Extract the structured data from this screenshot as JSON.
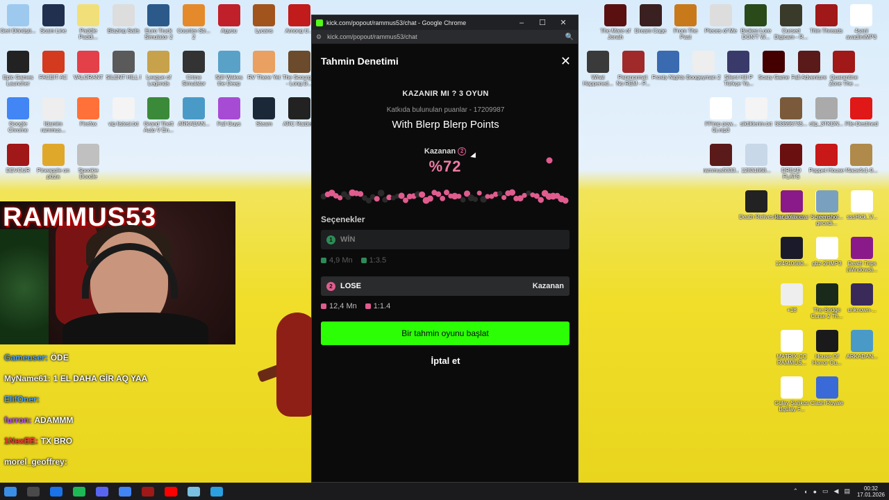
{
  "desktop": {
    "left_icons": [
      {
        "label": "Geri Dönüşü...",
        "color": "#9ec9ef"
      },
      {
        "label": "Scam Line",
        "color": "#22304f"
      },
      {
        "label": "Paddle Paddi...",
        "color": "#f1e07a"
      },
      {
        "label": "Blazing Sails",
        "color": "#ddd"
      },
      {
        "label": "Euro Truck Simulator 2",
        "color": "#2b5a8a"
      },
      {
        "label": "Counter-Str... 2",
        "color": "#e58a2a"
      },
      {
        "label": "Agyou",
        "color": "#c0202a"
      },
      {
        "label": "Lycans",
        "color": "#a2541d"
      },
      {
        "label": "Among U...",
        "color": "#c21b1b"
      },
      {
        "label": "Epic Games Launcher",
        "color": "#222"
      },
      {
        "label": "FACEIT AC",
        "color": "#d43a1d"
      },
      {
        "label": "VALORANT",
        "color": "#e3404a"
      },
      {
        "label": "SILENT HILL f",
        "color": "#5a5a5a"
      },
      {
        "label": "League of Legends",
        "color": "#c7a24a"
      },
      {
        "label": "Crime Simulator",
        "color": "#333"
      },
      {
        "label": "Still Wakes the Deep",
        "color": "#5aa1c7"
      },
      {
        "label": "RV There Yet",
        "color": "#e9a060"
      },
      {
        "label": "The Scourg... - Long D...",
        "color": "#6b4b2b"
      },
      {
        "label": "Google Chrome",
        "color": "#4285f4"
      },
      {
        "label": "İdamim rammus...",
        "color": "#eee"
      },
      {
        "label": "Firefox",
        "color": "#ff7139"
      },
      {
        "label": "vip listesi.txt",
        "color": "#f4f4f4"
      },
      {
        "label": "Grand Theft Auto V En...",
        "color": "#3a8a3a"
      },
      {
        "label": "ARKADAN...",
        "color": "#4a9ac8"
      },
      {
        "label": "Fall Guys",
        "color": "#a74bd5"
      },
      {
        "label": "Steam",
        "color": "#1b2838"
      },
      {
        "label": "ARC Raiders",
        "color": "#222"
      },
      {
        "label": "DEVOUR",
        "color": "#a01818"
      },
      {
        "label": "Pineapple on pizza",
        "color": "#e0a82a"
      },
      {
        "label": "Spookie Doodle",
        "color": "#c0c0c0"
      }
    ],
    "right_icons": [
      {
        "label": "The Mare of Jonah",
        "color": "#5a1010"
      },
      {
        "label": "Dream Cage",
        "color": "#3a2020"
      },
      {
        "label": "From The Past",
        "color": "#c87a1a"
      },
      {
        "label": "Pieces of Me",
        "color": "#ddd"
      },
      {
        "label": "Broken Lore DON'T W...",
        "color": "#2a4a1a"
      },
      {
        "label": "Cursed Digicam - R...",
        "color": "#3a3a2a"
      },
      {
        "label": "Thin Threads",
        "color": "#a01818"
      },
      {
        "label": "4sani avadiiniMP3",
        "color": "#fff"
      },
      {
        "label": "What Happened...",
        "color": "#3a3a3a"
      },
      {
        "label": "Paranormal: No REM - P...",
        "color": "#a02a2a"
      },
      {
        "label": "Frosty Nights",
        "color": "#3a6ab0"
      },
      {
        "label": "Boogeyman 2",
        "color": "#eee"
      },
      {
        "label": "Silent Hill P Türkçe Ya...",
        "color": "#3a3a6a"
      },
      {
        "label": "Scary Game",
        "color": "#400"
      },
      {
        "label": "Fall Adventure",
        "color": "#5a1a1a"
      },
      {
        "label": "Quarantine Zone The ...",
        "color": "#a01818"
      },
      {
        "label": "FFimp pow... 0).mp3",
        "color": "#fff"
      },
      {
        "label": "siktiklerim.txt",
        "color": "#f4f4f4"
      },
      {
        "label": "533595735...",
        "color": "#7a5a3a"
      },
      {
        "label": "clip_3TKDN...",
        "color": "#aaa"
      },
      {
        "label": "File-Destined",
        "color": "#e01818"
      },
      {
        "label": "rammus5333...",
        "color": "#5a1a1a"
      },
      {
        "label": "12831868...",
        "color": "#c8d8e8"
      },
      {
        "label": "DREAD FLATS",
        "color": "#6a1010"
      },
      {
        "label": "Poppet House",
        "color": "#c81818"
      },
      {
        "label": "f4aca4c1-0...",
        "color": "#b08a4a"
      },
      {
        "label": "Death Relives",
        "color": "#222"
      },
      {
        "label": "tarzan53nw...",
        "color": "#2a5a2a"
      },
      {
        "label": "anneme gecedi...",
        "color": "#fff"
      },
      {
        "label": "Rar dolaxicrar",
        "color": "#8a1a8a"
      },
      {
        "label": "Screenshot...",
        "color": "#7aa0c0"
      },
      {
        "label": "sssHktk_V...",
        "color": "#fff"
      },
      {
        "label": "124910680...",
        "color": "#1a1a2a"
      },
      {
        "label": "gbz-2HMP3",
        "color": "#fff"
      },
      {
        "label": "Death Trips (Windows)...",
        "color": "#8a1a8a"
      },
      {
        "label": "+18",
        "color": "#eee"
      },
      {
        "label": "The Bridge Curse 2 Th...",
        "color": "#1a2a1a"
      },
      {
        "label": "unknown-...",
        "color": "#3a2a5a"
      },
      {
        "label": "MATRIX ÇÇ RAMMUS...",
        "color": "#fff"
      },
      {
        "label": "House Of Horror Ou...",
        "color": "#1a1a1a"
      },
      {
        "label": "ARKADAN...",
        "color": "#4a9ac8"
      },
      {
        "label": "Gülay Şahkos Bgülay F...",
        "color": "#fff"
      },
      {
        "label": "Clash Royale",
        "color": "#3a6ad8"
      }
    ]
  },
  "webcam": {
    "overlay_text": "RAMMUS53"
  },
  "chat": {
    "lines": [
      {
        "user": "Gameuser:",
        "text": "ÖDE",
        "color": "#4aa3ff"
      },
      {
        "user": "MyName61:",
        "text": "1 EL DAHA GİR AQ YAA",
        "color": "#f5f5f5"
      },
      {
        "user": "ElifOner:",
        "text": "",
        "color": "#4aa3ff"
      },
      {
        "user": "furron:",
        "text": "ADAMMM",
        "color": "#bb55ff"
      },
      {
        "user": "1NexEE:",
        "text": "TX BRO",
        "color": "#ff3838"
      },
      {
        "user": "morel_geoffrey:",
        "text": "",
        "color": "#f5f5f5"
      }
    ]
  },
  "browser": {
    "window_title": "kick.com/popout/rammus53/chat - Google Chrome",
    "url": "kick.com/popout/rammus53/chat",
    "minimize": "–",
    "maximize": "☐",
    "close": "✕"
  },
  "prediction": {
    "panel_title": "Tahmin Denetimi",
    "close_label": "✕",
    "question": "KAZANIR MI ? 3 OYUN",
    "points_line": "Katkıda bulunulan puanlar - 17209987",
    "blerp_line": "With Blerp Blerp Points",
    "winner_label": "Kazanan",
    "winner_number": "2",
    "winner_percent": "%72",
    "options_label": "Seçenekler",
    "options": [
      {
        "number": "1",
        "name": "WİN",
        "amount": "4,9 Mn",
        "ratio": "1:3.5",
        "winner_tag": ""
      },
      {
        "number": "2",
        "name": "LOSE",
        "amount": "12,4 Mn",
        "ratio": "1:1.4",
        "winner_tag": "Kazanan"
      }
    ],
    "start_button": "Bir tahmin oyunu başlat",
    "cancel_button": "İptal et",
    "colors": {
      "accent": "#2cff05",
      "lose": "#e05c8e",
      "win": "#2e8b57"
    }
  },
  "taskbar": {
    "time": "00:32",
    "date": "17.01.2026"
  }
}
